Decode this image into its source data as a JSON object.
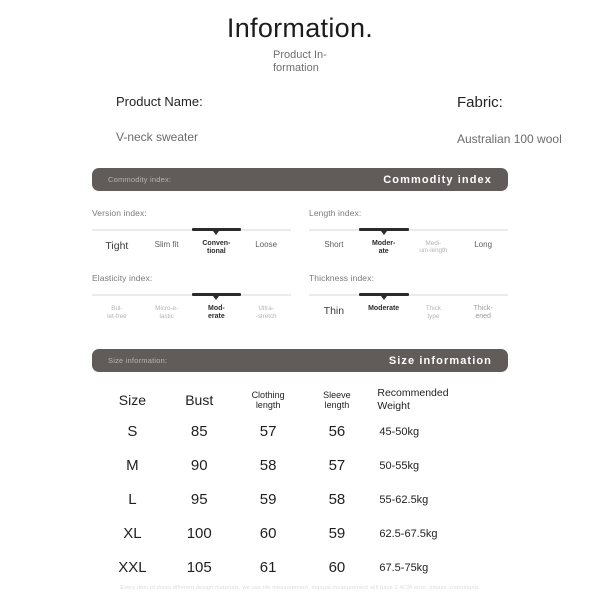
{
  "header": {
    "title": "Information.",
    "subtitle": "Product In-formation"
  },
  "product": {
    "name_label": "Product Name:",
    "name_value": "V-neck sweater",
    "fabric_label": "Fabric:",
    "fabric_value": "Australian 100 wool"
  },
  "commodity_section": {
    "bar_left": "Commodity index:",
    "bar_right": "Commodity index"
  },
  "indices": [
    {
      "title": "Version index:",
      "ticks": [
        "Tight",
        "Slim fit",
        "Conven-\ntional",
        "Loose"
      ],
      "tick_sizes": [
        "lg",
        "md",
        "sm",
        "md"
      ],
      "selected": 2
    },
    {
      "title": "Length index:",
      "ticks": [
        "Short",
        "Moder-\nate",
        "Medi-\num-length",
        "Long"
      ],
      "tick_sizes": [
        "md",
        "sm",
        "xs",
        "md"
      ],
      "selected": 1
    },
    {
      "title": "Elasticity index:",
      "ticks": [
        "Bul-\nlet-free",
        "Micro-e-\nlastic",
        "Mod-\nerate",
        "Ultra-\n-stretch"
      ],
      "tick_sizes": [
        "xs",
        "xs",
        "sm",
        "xs"
      ],
      "selected": 2
    },
    {
      "title": "Thickness index:",
      "ticks": [
        "Thin",
        "Moderate",
        "Thick\ntype",
        "Thick-\nened"
      ],
      "tick_sizes": [
        "lg",
        "sm",
        "xs",
        "sm"
      ],
      "selected": 1
    }
  ],
  "size_section": {
    "bar_left": "Size information:",
    "bar_right": "Size information"
  },
  "size_table": {
    "headers": [
      "Size",
      "Bust",
      "Clothing\nlength",
      "Sleeve\nlength",
      "Recommended\nWeight"
    ],
    "rows": [
      [
        "S",
        "85",
        "57",
        "56",
        "45-50kg"
      ],
      [
        "M",
        "90",
        "58",
        "57",
        "50-55kg"
      ],
      [
        "L",
        "95",
        "59",
        "58",
        "55-62.5kg"
      ],
      [
        "XL",
        "100",
        "60",
        "59",
        "62.5-67.5kg"
      ],
      [
        "XXL",
        "105",
        "61",
        "60",
        "67.5-75kg"
      ]
    ]
  },
  "footer": {
    "note": "Every item of dress different design materials, we use tile measurement, manual measurement will have 2-4CM error, please understand."
  },
  "colors": {
    "bar_background": "#615c5a",
    "track_active": "#2b2b2b",
    "track_inactive": "#ebebeb"
  }
}
